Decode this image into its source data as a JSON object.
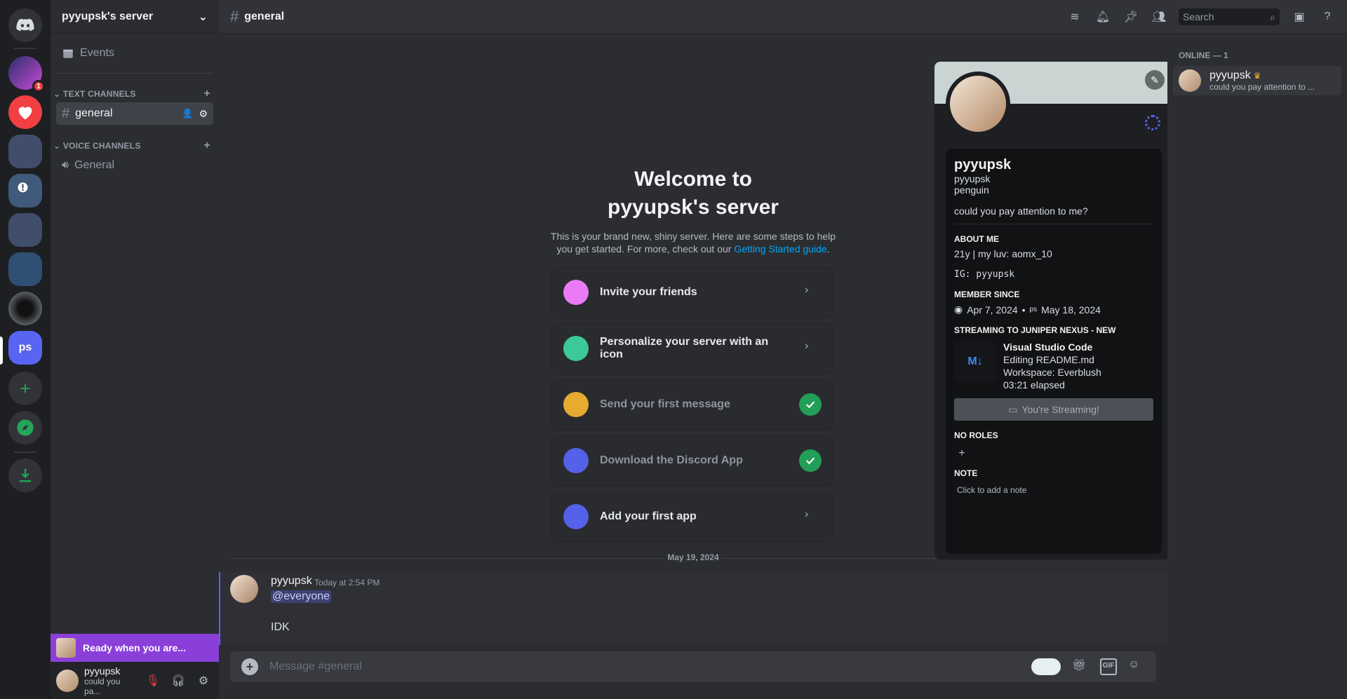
{
  "server": {
    "name": "pyyupsk's server",
    "rail": [
      {
        "name": "discord-home",
        "label": ""
      },
      {
        "name": "juniper-nexus",
        "label": "",
        "badge": "1"
      },
      {
        "name": "red-heart-server",
        "label": ""
      },
      {
        "name": "server-group-1",
        "label": ""
      },
      {
        "name": "alert-server",
        "label": ""
      },
      {
        "name": "server-group-2",
        "label": ""
      },
      {
        "name": "server-group-3",
        "label": ""
      },
      {
        "name": "dark-orb-server",
        "label": ""
      },
      {
        "name": "ps-server",
        "label": "ps"
      }
    ]
  },
  "sidebar": {
    "events_label": "Events",
    "text_category": "TEXT CHANNELS",
    "voice_category": "VOICE CHANNELS",
    "text_channels": [
      {
        "label": "general"
      }
    ],
    "voice_channels": [
      {
        "label": "General"
      }
    ]
  },
  "promo": {
    "label": "Ready when you are..."
  },
  "user_panel": {
    "name": "pyyupsk",
    "status": "could you pa..."
  },
  "topbar": {
    "channel": "general",
    "search_placeholder": "Search"
  },
  "welcome": {
    "title_line1": "Welcome to",
    "title_line2": "pyyupsk's server",
    "desc_before": "This is your brand new, shiny server. Here are some steps to help you get started. For more, check out our ",
    "link": "Getting Started guide",
    "desc_after": "."
  },
  "steps": [
    {
      "label": "Invite your friends",
      "done": false,
      "color": "#f47fff"
    },
    {
      "label": "Personalize your server with an icon",
      "done": false,
      "color": "#3fd1a0"
    },
    {
      "label": "Send your first message",
      "done": true,
      "color": "#f0b232"
    },
    {
      "label": "Download the Discord App",
      "done": true,
      "color": "#5865f2"
    },
    {
      "label": "Add your first app",
      "done": false,
      "color": "#5865f2"
    }
  ],
  "date_divider": "May 19, 2024",
  "message": {
    "author": "pyyupsk",
    "timestamp": "Today at 2:54 PM",
    "mention": "@everyone",
    "text": "IDK"
  },
  "composer": {
    "placeholder": "Message #general"
  },
  "profile": {
    "display_name": "pyyupsk",
    "username": "pyyupsk",
    "pronouns": "penguin",
    "status": "could you pay attention to me?",
    "about_heading": "ABOUT ME",
    "about_line1": "21y | my luv:  aomx_10",
    "about_line2": "IG: pyyupsk",
    "member_since_heading": "MEMBER SINCE",
    "discord_since": "Apr 7, 2024",
    "server_since": "May 18, 2024",
    "streaming_heading": "STREAMING TO JUNIPER NEXUS - NEW",
    "activity": {
      "app": "Visual Studio Code",
      "details": "Editing README.md",
      "state": "Workspace: Everblush",
      "elapsed": "03:21 elapsed"
    },
    "streaming_button": "You're Streaming!",
    "roles_heading": "NO ROLES",
    "note_heading": "NOTE",
    "note_placeholder": "Click to add a note"
  },
  "members": {
    "header": "ONLINE — 1",
    "list": [
      {
        "name": "pyyupsk",
        "status": "could you pay attention to ..."
      }
    ]
  },
  "colors": {
    "accent": "#5865f2",
    "success": "#23a55a",
    "promo": "#8b3fd9"
  }
}
